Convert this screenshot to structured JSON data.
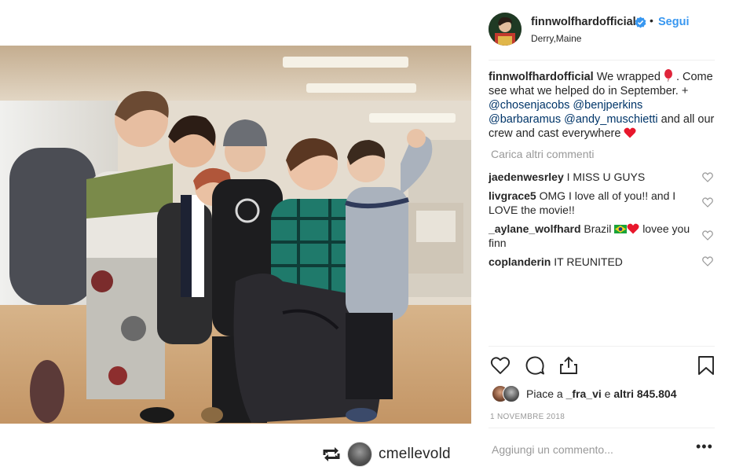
{
  "post": {
    "username": "finnwolfhardofficial",
    "verified": true,
    "follow_label": "Segui",
    "dot": "•",
    "location": "Derry,Maine",
    "caption": {
      "user": "finnwolfhardofficial",
      "text_1": "We wrapped",
      "text_2": ". Come see what we helped do in September. +",
      "mentions": [
        "@chosenjacobs",
        "@benjperkins",
        "@barbaramus",
        "@andy_muschietti"
      ],
      "and": "and all our crew and cast everywhere"
    },
    "load_more_label": "Carica altri commenti",
    "comments": [
      {
        "user": "jaedenwesrley",
        "text": "I MISS U GUYS"
      },
      {
        "user": "livgrace5",
        "text": "OMG I love all of you!! and I LOVE the movie!!"
      },
      {
        "user": "_aylane_wolfhard",
        "text_1": "Brazil",
        "text_2": "lovee you finn"
      },
      {
        "user": "coplanderin",
        "text": "IT REUNITED"
      }
    ],
    "likes": {
      "prefix": "Piace a",
      "user": "_fra_vi",
      "middle": "e",
      "count": "altri 845.804"
    },
    "date": "1 NOVEMBRE 2018",
    "add_comment_placeholder": "Aggiungi un commento...",
    "more_label": "•••"
  },
  "repost": {
    "username": "cmellevold"
  },
  "icons": {
    "verified": "verified-badge-icon",
    "like": "heart-icon",
    "comment": "comment-bubble-icon",
    "share": "share-icon",
    "save": "bookmark-icon",
    "repost": "repost-icon"
  },
  "colors": {
    "link": "#3897f0",
    "mention": "#003569",
    "muted": "#999999",
    "text": "#262626"
  }
}
